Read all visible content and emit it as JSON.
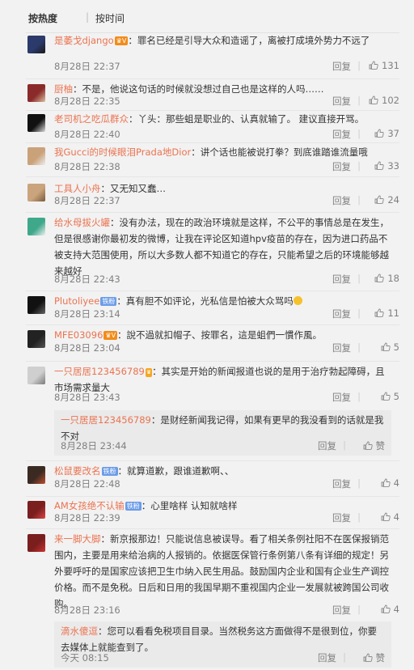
{
  "sort": {
    "hot": "按热度",
    "time": "按时间"
  },
  "comments": [
    {
      "user": "是萎戈django",
      "badges": [
        "vip"
      ],
      "text": "：罪名已经是引导大众和造谣了，离被打成境外势力不远了",
      "time": "8月28日 22:37",
      "reply": "回复",
      "likes": "131"
    },
    {
      "user": "厨柚",
      "badges": [],
      "text": "：不是，他说这句话的时候就没想过自己也是这样的人吗……",
      "time": "8月28日 22:35",
      "reply": "回复",
      "likes": "102"
    },
    {
      "user": "老司机之吃瓜群众",
      "badges": [],
      "text": "：丫头：那些蛆是职业的、认真就输了。 建议直接开骂。",
      "time": "8月28日 22:40",
      "reply": "回复",
      "likes": "37"
    },
    {
      "user": "我Gucci的时候眼泪Prada地Dior",
      "badges": [],
      "text": "：讲个话也能被说打拳？到底谁踏谁流量哦",
      "time": "8月28日 22:38",
      "reply": "回复",
      "likes": "33"
    },
    {
      "user": "工具人小舟",
      "badges": [],
      "text": "：又无知又蠢…",
      "time": "8月28日 22:37",
      "reply": "回复",
      "likes": "24"
    },
    {
      "user": "给水母拔火罐",
      "badges": [],
      "text": "：没有办法，现在的政治环境就是这样，不公平的事情总是在发生，但是很感谢你最初发的微博，让我在评论区知道hpv疫苗的存在，因为进口药品不被支持大范围使用，所以大多数人都不知道它的存在，只能希望之后的环境能够越来越好",
      "time": "8月28日 22:43",
      "reply": "回复",
      "likes": "18"
    },
    {
      "user": "Plutoliyee",
      "badges": [
        "fan"
      ],
      "text": "：真有胆不如评论，光私信是怕被大众骂吗",
      "time": "8月28日 23:14",
      "reply": "回复",
      "likes": "11"
    },
    {
      "user": "MFE03096",
      "badges": [
        "vip"
      ],
      "text": "：說不過就扣帽子、按罪名，這是蛆們一慣作風。",
      "time": "8月28日 23:04",
      "reply": "回复",
      "likes": "5"
    },
    {
      "user": "一只居居123456789",
      "badges": [
        "crown"
      ],
      "text": "：其实是开始的新闻报道也说的是用于治疗勃起障碍，且市场需求量大",
      "time": "8月28日 23:43",
      "reply": "回复",
      "likes": "5"
    },
    {
      "user": "松鼠要改名",
      "badges": [
        "fan"
      ],
      "text": "：就算道歉，跟谁道歉啊、、",
      "time": "8月28日 22:48",
      "reply": "回复",
      "likes": "4"
    },
    {
      "user": "AM女孩绝不认输",
      "badges": [
        "fan"
      ],
      "text": "：心里啥样 认知就啥样",
      "time": "8月28日 22:39",
      "reply": "回复",
      "likes": "4"
    },
    {
      "user": "来一脚大脚",
      "badges": [],
      "text": "：新京报那边！只能说信息被误导。看了相关条例社阳不在医保报销范围内，主要是用来给治病的人报销的。依据医保管行条例第八条有详细的规定！另外要呼吁的是国家应该把卫生巾纳入民生用品。鼓励国内企业和国有企业生产调控价格。而不是免税。日后和日用的我国早期不重视国内企业一发展就被跨国公司收购。",
      "time": "8月28日 23:16",
      "reply": "回复",
      "likes": "4"
    }
  ],
  "replies": [
    {
      "user": "一只居居123456789",
      "badges": [],
      "text": "：是财经新闻我记得，如果有更早的我没看到的话就是我不对",
      "time": "8月28日 23:44",
      "reply": "回复",
      "likes": "赞"
    },
    {
      "user": "滴水傻逗",
      "badges": [],
      "text": "：您可以看看免税项目目录。当然税务这方面做得不是很到位，你要去媒体上就能查到了。",
      "time": "今天 08:15",
      "reply": "回复",
      "likes": "赞"
    }
  ],
  "colors": {
    "username": "#eb7350",
    "meta": "#808080",
    "background": "#f2f2f2"
  },
  "icons": {
    "like": "thumb-up-icon",
    "vip": "vip-badge-icon",
    "fan": "fan-badge-icon",
    "crown": "crown-badge-icon",
    "emoji": "smile-emoji-icon"
  }
}
